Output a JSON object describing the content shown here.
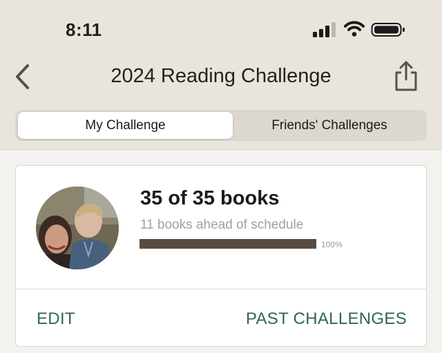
{
  "status_bar": {
    "time": "8:11",
    "icons": [
      "cellular-signal-icon",
      "wifi-icon",
      "battery-icon"
    ]
  },
  "nav": {
    "back_icon": "chevron-left-icon",
    "title": "2024 Reading Challenge",
    "share_icon": "share-icon"
  },
  "tabs": [
    {
      "label": "My Challenge",
      "selected": true
    },
    {
      "label": "Friends' Challenges",
      "selected": false
    }
  ],
  "challenge": {
    "progress_text": "35 of 35 books",
    "schedule_text": "11 books ahead of schedule",
    "progress_fraction": 1.0,
    "progress_percent_label": "100%",
    "avatar": "user-photo"
  },
  "actions": {
    "edit_label": "EDIT",
    "past_label": "PAST CHALLENGES"
  },
  "colors": {
    "header_bg": "#e9e5dc",
    "page_bg": "#f4f2ee",
    "progress_fill": "#5a4b41",
    "action_text": "#2e6655"
  }
}
